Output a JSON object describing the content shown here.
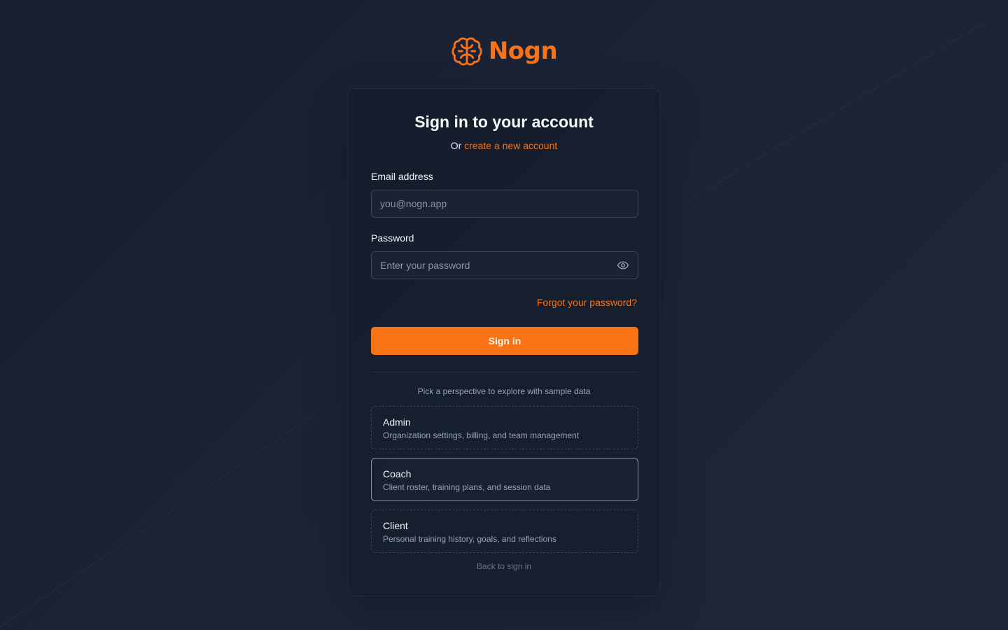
{
  "brand": {
    "name": "Nogn",
    "icon": "brain-icon",
    "accent": "#f97316"
  },
  "form": {
    "title": "Sign in to your account",
    "subtitle_prefix": "Or",
    "create_account_link": "create a new account",
    "email": {
      "label": "Email address",
      "value": "",
      "placeholder": "you@nogn.app"
    },
    "password": {
      "label": "Password",
      "value": "",
      "placeholder": "Enter your password",
      "toggle_icon": "eye-icon"
    },
    "forgot_link": "Forgot your password?",
    "submit_label": "Sign in"
  },
  "demo": {
    "hint": "Pick a perspective to explore with sample data",
    "personas": [
      {
        "name": "Admin",
        "description": "Organization settings, billing, and team management",
        "selected": false
      },
      {
        "name": "Coach",
        "description": "Client roster, training plans, and session data",
        "selected": true
      },
      {
        "name": "Client",
        "description": "Personal training history, goals, and reflections",
        "selected": false
      }
    ],
    "back_link": "Back to sign in"
  }
}
